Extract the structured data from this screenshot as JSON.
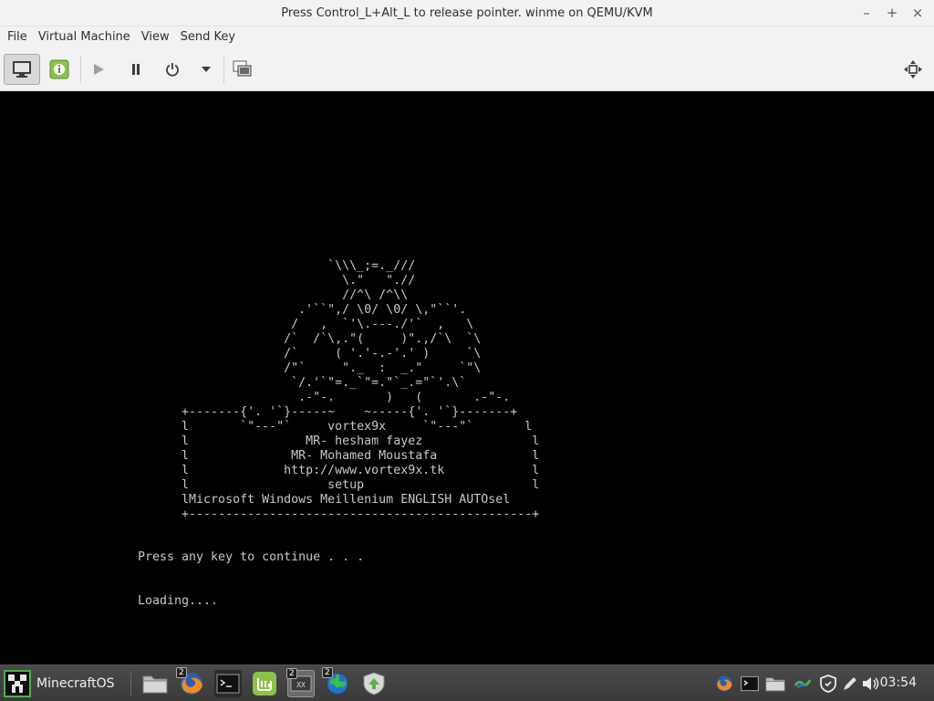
{
  "window": {
    "title": "Press Control_L+Alt_L to release pointer. winme on QEMU/KVM",
    "controls": [
      "minimize",
      "maximize",
      "close"
    ]
  },
  "menubar": {
    "items": [
      "File",
      "Virtual Machine",
      "View",
      "Send Key"
    ]
  },
  "toolbar": {
    "buttons": [
      "show-console",
      "show-details",
      "run",
      "pause",
      "power",
      "power-menu",
      "snapshots",
      "fullscreen"
    ]
  },
  "vm": {
    "ascii_art": "                          `\\\\\\_;=._///\n                            \\.\"   \".//\n                            //^\\ /^\\\\\n                      .'``\",/ \\0/ \\0/ \\,\"``'.\n                     /   ,  `'\\.---./'`  ,   \\\n                    /`  /`\\,.\"(     )\".,/`\\  `\\\n                    /`     ( '.'-.-'.' )     `\\\n                    /\"`     \"._  :  _.\"     `\"\\\n                     `/.'`\"=._`\"=.\"`_.=\"`'.\\`\n                      .-\"-.       )   (       .-\"-.\n      +-------{'. '`}-----~    ~-----{'. '`}-------+\n      l       `\"---\"`     vortex9x     `\"---\"`       l\n      l                MR- hesham fayez               l\n      l              MR- Mohamed Moustafa             l\n      l             http://www.vortex9x.tk            l\n      l                   setup                       l\n      lMicrosoft Windows Meillenium ENGLISH AUTOsel\n      +-----------------------------------------------+",
    "prompt": "Press any key to continue . . .",
    "loading": "Loading...."
  },
  "taskbar": {
    "start_label": "MinecraftOS",
    "apps": [
      {
        "name": "files",
        "badge": ""
      },
      {
        "name": "firefox",
        "badge": "2"
      },
      {
        "name": "terminal",
        "badge": ""
      },
      {
        "name": "mint-software",
        "badge": ""
      },
      {
        "name": "virt-manager",
        "badge": "2"
      },
      {
        "name": "download-manager",
        "badge": "2"
      },
      {
        "name": "update-manager",
        "badge": ""
      }
    ],
    "tray": [
      "firefox",
      "terminal",
      "files",
      "network-tool",
      "shield",
      "pen",
      "volume"
    ],
    "clock": "03:54"
  },
  "colors": {
    "chrome_bg": "#f2f2f2",
    "vm_bg": "#000000",
    "vm_text": "#c8c8c8",
    "taskbar_bg": "#3f3f3f",
    "accent_green": "#8bc34a"
  }
}
